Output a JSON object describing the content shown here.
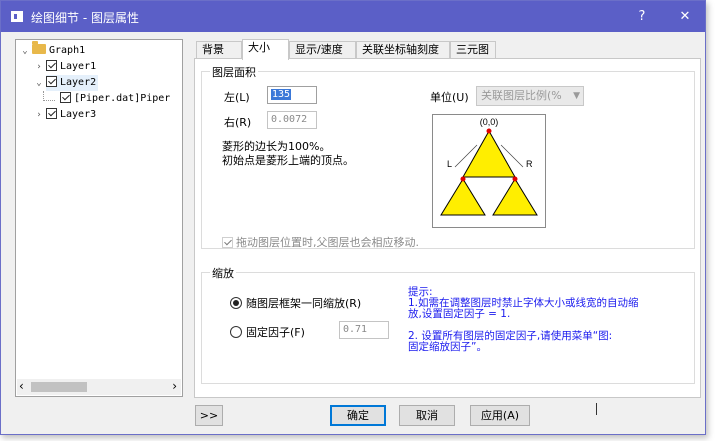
{
  "window": {
    "title": "绘图细节 - 图层属性",
    "help_label": "?",
    "close_label": "✕"
  },
  "tree": {
    "items": [
      {
        "label": "Graph1",
        "twisty": "⌄",
        "kind": "folder"
      },
      {
        "label": "Layer1",
        "twisty": "›",
        "kind": "checked"
      },
      {
        "label": "Layer2",
        "twisty": "⌄",
        "kind": "checked"
      },
      {
        "label": "[Piper.dat]Piper",
        "twisty": "",
        "kind": "checked"
      },
      {
        "label": "Layer3",
        "twisty": "›",
        "kind": "checked"
      }
    ],
    "scroll_left": "‹",
    "scroll_right": "›"
  },
  "tabs": [
    "背景",
    "大小",
    "显示/速度",
    "关联坐标轴刻度",
    "三元图"
  ],
  "active_tab": 1,
  "layer_area": {
    "group_title": "图层面积",
    "left_label": "左(L)",
    "left_value": "135",
    "right_label": "右(R)",
    "right_value": "0.0072",
    "desc_line1": "菱形的边长为100%。",
    "desc_line2": "初始点是菱形上端的顶点。",
    "unit_label": "单位(U)",
    "unit_value": "关联图层比例(%",
    "diagram_top": "(0,0)",
    "diagram_left": "L",
    "diagram_right": "R",
    "drag_check_label": "拖动图层位置时,父图层也会相应移动."
  },
  "scale": {
    "group_title": "缩放",
    "radio1_label": "随图层框架一同缩放(R)",
    "radio2_label": "固定因子(F)",
    "factor_value": "0.71",
    "hint_title": "提示:",
    "hint_line1": "1.如需在调整图层时禁止字体大小或线宽的自动缩",
    "hint_line2": "放,设置固定因子  = 1.",
    "hint_line3": "2. 设置所有图层的固定因子,请使用菜单“图:",
    "hint_line4": "固定缩放因子”。"
  },
  "buttons": {
    "expand": ">>",
    "ok": "确定",
    "cancel": "取消",
    "apply": "应用(A)"
  },
  "colors": {
    "titlebar": "#5b5fc7",
    "hint_text": "#1a1aee",
    "triangle_fill": "#ffee00"
  }
}
